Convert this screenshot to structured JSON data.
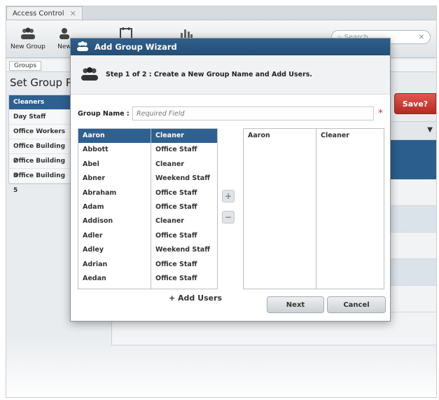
{
  "app": {
    "tab_title": "Access Control",
    "tab_close": "✕",
    "toolbar": {
      "new_group": "New Group",
      "new_partial": "New"
    },
    "search_placeholder": "Search",
    "search_clear": "✕",
    "breadcrumb": "Groups",
    "page_title": "Set Group Per",
    "groups": [
      "Cleaners",
      "Day Staff",
      "Office Workers",
      "Office Building 2",
      "Office Building 3",
      "Office Building 5"
    ],
    "save_label": "Save?"
  },
  "wizard": {
    "title": "Add Group Wizard",
    "step_text": "Step 1 of 2 : Create a New Group Name and Add Users.",
    "group_name_label": "Group Name :",
    "group_name_placeholder": "Required Field",
    "required_mark": "*",
    "available_users": [
      {
        "name": "Aaron",
        "role": "Cleaner"
      },
      {
        "name": "Abbott",
        "role": "Office Staff"
      },
      {
        "name": "Abel",
        "role": "Cleaner"
      },
      {
        "name": "Abner",
        "role": "Weekend Staff"
      },
      {
        "name": "Abraham",
        "role": "Office Staff"
      },
      {
        "name": "Adam",
        "role": "Office Staff"
      },
      {
        "name": "Addison",
        "role": "Cleaner"
      },
      {
        "name": "Adler",
        "role": "Office Staff"
      },
      {
        "name": "Adley",
        "role": "Weekend Staff"
      },
      {
        "name": "Adrian",
        "role": "Office Staff"
      },
      {
        "name": "Aedan",
        "role": "Office Staff"
      }
    ],
    "selected_users": [
      {
        "name": "Aaron",
        "role": "Cleaner"
      }
    ],
    "plus": "+",
    "minus": "−",
    "add_users_label": "+ Add Users",
    "next_label": "Next",
    "cancel_label": "Cancel"
  },
  "colors": {
    "title_bar": "#2b5a87",
    "selection": "#2e6090",
    "save_red": "#c9342b"
  }
}
